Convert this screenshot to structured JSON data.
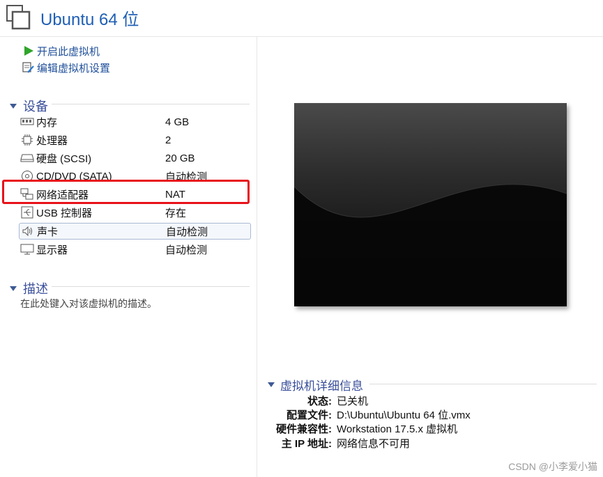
{
  "window": {
    "title": "Ubuntu 64 位"
  },
  "actions": [
    {
      "label": "开启此虚拟机",
      "icon": "play-icon"
    },
    {
      "label": "编辑虚拟机设置",
      "icon": "edit-settings-icon"
    }
  ],
  "devices": {
    "section_title": "设备",
    "items": [
      {
        "name": "内存",
        "value": "4 GB",
        "icon": "memory-icon"
      },
      {
        "name": "处理器",
        "value": "2",
        "icon": "processor-icon"
      },
      {
        "name": "硬盘 (SCSI)",
        "value": "20 GB",
        "icon": "hard-disk-icon"
      },
      {
        "name": "CD/DVD (SATA)",
        "value": "自动检测",
        "icon": "cd-dvd-icon"
      },
      {
        "name": "网络适配器",
        "value": "NAT",
        "icon": "network-adapter-icon"
      },
      {
        "name": "USB 控制器",
        "value": "存在",
        "icon": "usb-icon"
      },
      {
        "name": "声卡",
        "value": "自动检测",
        "icon": "sound-card-icon"
      },
      {
        "name": "显示器",
        "value": "自动检测",
        "icon": "display-icon"
      }
    ]
  },
  "description": {
    "section_title": "描述",
    "placeholder": "在此处键入对该虚拟机的描述。"
  },
  "details": {
    "section_title": "虚拟机详细信息",
    "rows": [
      {
        "label": "状态:",
        "value": "已关机"
      },
      {
        "label": "配置文件:",
        "value": "D:\\Ubuntu\\Ubuntu 64 位.vmx"
      },
      {
        "label": "硬件兼容性:",
        "value": "Workstation 17.5.x 虚拟机"
      },
      {
        "label": "主 IP 地址:",
        "value": "网络信息不可用"
      }
    ]
  },
  "watermark": "CSDN @小李爱小猫",
  "colors": {
    "accent": "#1f5fb4",
    "section": "#3a4f9a",
    "highlight": "#e8121a"
  }
}
